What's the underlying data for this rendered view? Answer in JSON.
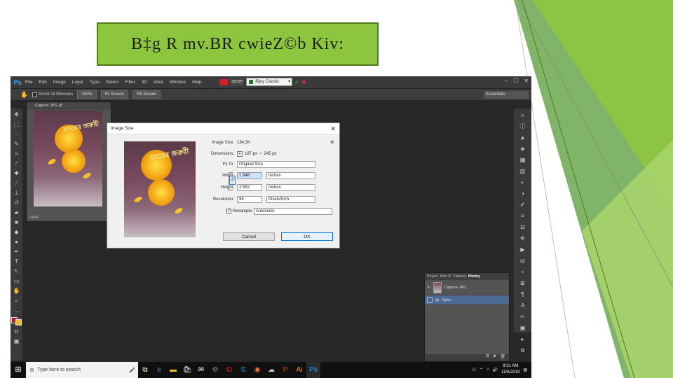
{
  "slide": {
    "title": "B‡g R mv.BR cwieZ©b Kiv:",
    "colors": {
      "title_bg": "#8cc63f",
      "accent_dark": "#4d7a1a",
      "accent_light": "#a7d36b"
    }
  },
  "photoshop": {
    "logo": "Ps",
    "menu": [
      "File",
      "Edit",
      "Image",
      "Layer",
      "Type",
      "Select",
      "Filter",
      "3D",
      "View",
      "Window",
      "Help"
    ],
    "font_label": "বাংলা",
    "font_name": "Bijoy Classic",
    "options": {
      "scroll_all_windows": "Scroll All Windows",
      "zoom_100": "100%",
      "fit_screen": "Fit Screen",
      "fill_screen": "Fill Screen"
    },
    "workspace": "Essentials",
    "document": {
      "tab": "Capture.JPG @ ...",
      "zoom": "100%"
    },
    "cover_title": "বসন্তের জরুরী",
    "dialog": {
      "title": "Image Size",
      "image_size_label": "Image Size:",
      "image_size_value": "134.2K",
      "dimensions_label": "Dimensions:",
      "dimensions_value": "187 px",
      "dimensions_x": "×",
      "dimensions_h": "245 px",
      "fit_to_label": "Fit To:",
      "fit_to_value": "Original Size",
      "width_label": "Width:",
      "width_value": "1.948",
      "width_unit": "Inches",
      "height_label": "Height:",
      "height_value": "2.552",
      "height_unit": "Inches",
      "resolution_label": "Resolution:",
      "resolution_value": "96",
      "resolution_unit": "Pixels/Inch",
      "resample_label": "Resample:",
      "resample_value": "Automatic",
      "cancel": "Cancel",
      "ok": "OK"
    },
    "history": {
      "tabs": [
        "Project",
        "Pool Fl",
        "Patterns",
        "History"
      ],
      "snapshot": "Capture.JPG",
      "state": "Open"
    }
  },
  "taskbar": {
    "search_placeholder": "Type here to search",
    "time": "9:31 AM",
    "date": "11/5/2019"
  }
}
